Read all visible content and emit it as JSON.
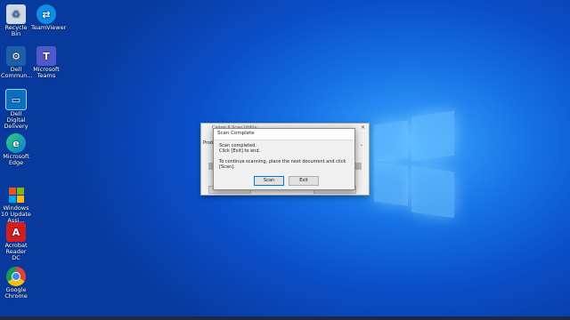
{
  "desktop": {
    "icons": [
      {
        "label": "Recycle Bin",
        "icon": "recycle-bin-icon"
      },
      {
        "label": "TeamViewer",
        "icon": "teamviewer-icon"
      },
      {
        "label": "Dell Commun...",
        "icon": "dell-command-icon"
      },
      {
        "label": "Microsoft Teams",
        "icon": "teams-icon"
      },
      {
        "label": "Dell Digital Delivery",
        "icon": "dell-digital-delivery-icon"
      },
      {
        "label": "Microsoft Edge",
        "icon": "edge-icon"
      },
      {
        "label": "Windows 10 Update Assi...",
        "icon": "windows-update-icon"
      },
      {
        "label": "Acrobat Reader DC",
        "icon": "acrobat-icon"
      },
      {
        "label": "Google Chrome",
        "icon": "chrome-icon"
      }
    ]
  },
  "app_window": {
    "title": "Canon IJ Scan Utility",
    "product_label": "Produ"
  },
  "dialog": {
    "title": "Scan Complete",
    "line1": "Scan completed.",
    "line2": "Click [Exit] to end.",
    "line3": "To continue scanning, place the next document and click [Scan].",
    "scan_label": "Scan",
    "exit_label": "Exit"
  },
  "colors": {
    "desktop_accent": "#1672e6",
    "focus_border": "#0078d7"
  }
}
